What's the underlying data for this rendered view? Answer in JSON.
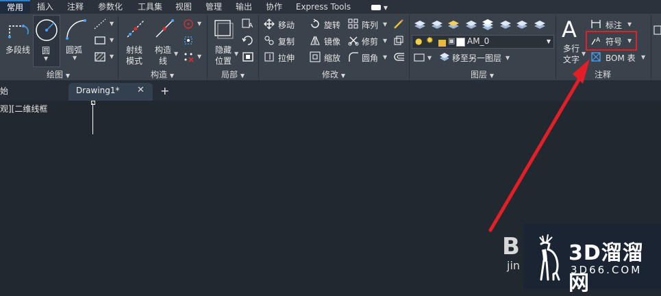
{
  "ribbon_tabs": [
    "常用",
    "插入",
    "注释",
    "参数化",
    "工具集",
    "视图",
    "管理",
    "输出",
    "协作",
    "Express Tools"
  ],
  "draw_panel": {
    "title": "绘图",
    "polyline": "多段线",
    "circle": "圆",
    "arc": "圆弧"
  },
  "construct_panel": {
    "title": "构造",
    "ray_mode": [
      "射线",
      "模式"
    ],
    "construct_line": [
      "构造",
      "线"
    ]
  },
  "local_panel": {
    "title": "局部",
    "hide_pos": [
      "隐藏",
      "位置"
    ]
  },
  "modify_panel": {
    "title": "修改",
    "move": "移动",
    "rotate": "旋转",
    "array": "阵列",
    "copy": "复制",
    "mirror": "镜像",
    "trim": "修剪",
    "stretch": "拉伸",
    "scale": "缩放",
    "fillet": "圆角"
  },
  "layer_panel": {
    "title": "图层",
    "current_layer": "AM_0",
    "move_to_layer": "移至另一图层"
  },
  "annotation_panel": {
    "title": "注释",
    "mtext": [
      "多行",
      "文字"
    ],
    "dimension": "标注",
    "symbol": "符号",
    "bom": "BOM 表"
  },
  "file_tabs": {
    "start": "始",
    "drawing": "Drawing1*"
  },
  "viewport_label": "观][二维线框",
  "watermark": {
    "cn": "3D溜溜网",
    "en": "3D66.COM",
    "partial": "B",
    "partial2": "jin"
  },
  "colors": {
    "ribbon_bg": "#3a424c",
    "canvas_bg": "#212830",
    "accent_blue": "#2f7bd8",
    "highlight_red": "#e0202a",
    "arrow_red": "#e41e26"
  }
}
